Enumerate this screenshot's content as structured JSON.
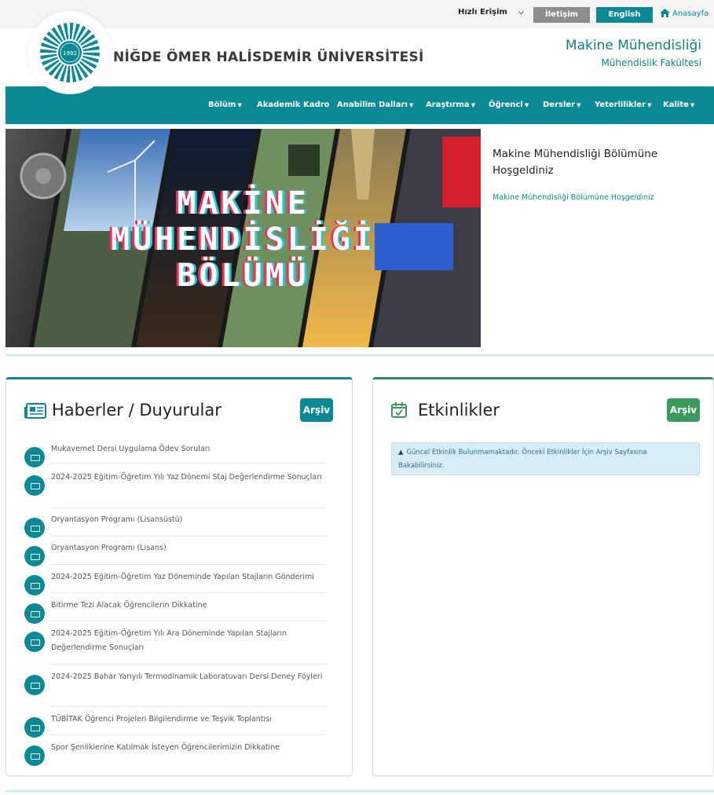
{
  "topbar": {
    "quick_access": "Hızlı Erişim",
    "contact": "İletişim",
    "english": "English",
    "home": "Anasayfa"
  },
  "header": {
    "logo_year": "1992",
    "university": "NİĞDE ÖMER HALİSDEMİR ÜNİVERSİTESİ",
    "department": "Makine Mühendisliği",
    "faculty": "Mühendislik Fakültesi"
  },
  "nav": {
    "items": [
      "Bölüm",
      "Akademik Kadro",
      "Anabilim Dalları",
      "Araştırma",
      "Öğrenci",
      "Dersler",
      "Yeterlilikler",
      "Kalite"
    ]
  },
  "hero": {
    "line1": "MAKİNE",
    "line2": "MÜHENDİSLİĞİ",
    "line3": "BÖLÜMÜ",
    "welcome_title": "Makine Mühendisliği Bölümüne Hoşgeldiniz",
    "welcome_link": "Makine Mühendisliği Bölümüne Hoşgeldiniz"
  },
  "news": {
    "title": "Haberler / Duyurular",
    "archive": "Arşiv",
    "items": [
      "Mukavemet Dersi Uygulama Ödev Soruları",
      "2024-2025 Eğitim-Öğretim Yılı Yaz Dönemi Staj Değerlendirme Sonuçları",
      "Oryantasyon Programı (Lisansüstü)",
      "Oryantasyon Programı (Lisans)",
      "2024-2025 Eğitim-Öğretim Yaz Döneminde Yapılan Stajların Gönderimi",
      "Bitirme Tezi Alacak Öğrencilerin Dikkatine",
      "2024-2025 Eğitim-Öğretim Yılı Ara Döneminde Yapılan Stajların Değerlendirme Sonuçları",
      "2024-2025 Bahar Yarıyılı Termodinamik Laboratuvarı Dersi Deney Föyleri",
      "TÜBİTAK Öğrenci Projeleri Bilgilendirme ve Teşvik Toplantısı",
      "Spor Şenliklerine Katılmak İsteyen Öğrencilerimizin Dikkatine"
    ]
  },
  "events": {
    "title": "Etkinlikler",
    "archive": "Arşiv",
    "notice": "Güncel Etkinlik Bulunmamaktadır. Önceki Etkinlikler İçin Arşiv Sayfasına Bakabilirsiniz."
  },
  "colors": {
    "primary": "#0b8a96",
    "green": "#3a9a5c",
    "header_text": "#13807e"
  }
}
